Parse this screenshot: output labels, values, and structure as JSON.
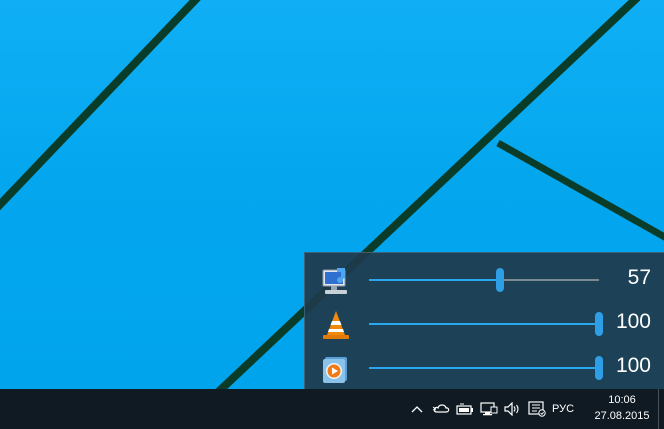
{
  "mixer": {
    "rows": [
      {
        "icon": "system-sounds-icon",
        "volume": 57,
        "label": "57"
      },
      {
        "icon": "vlc-icon",
        "volume": 100,
        "label": "100"
      },
      {
        "icon": "media-player-icon",
        "volume": 100,
        "label": "100"
      }
    ]
  },
  "taskbar": {
    "tray_icons": [
      "chevron-up-icon",
      "cloud-sync-icon",
      "battery-icon",
      "network-icon",
      "speaker-icon",
      "notifications-icon"
    ],
    "language": "РУС",
    "time": "10:06",
    "date": "27.08.2015"
  },
  "colors": {
    "desktop": "#00a4ed",
    "taskbar": "#0f1a22",
    "mixer_bg": "#1f3a4b",
    "slider_accent": "#2aa8ee"
  }
}
